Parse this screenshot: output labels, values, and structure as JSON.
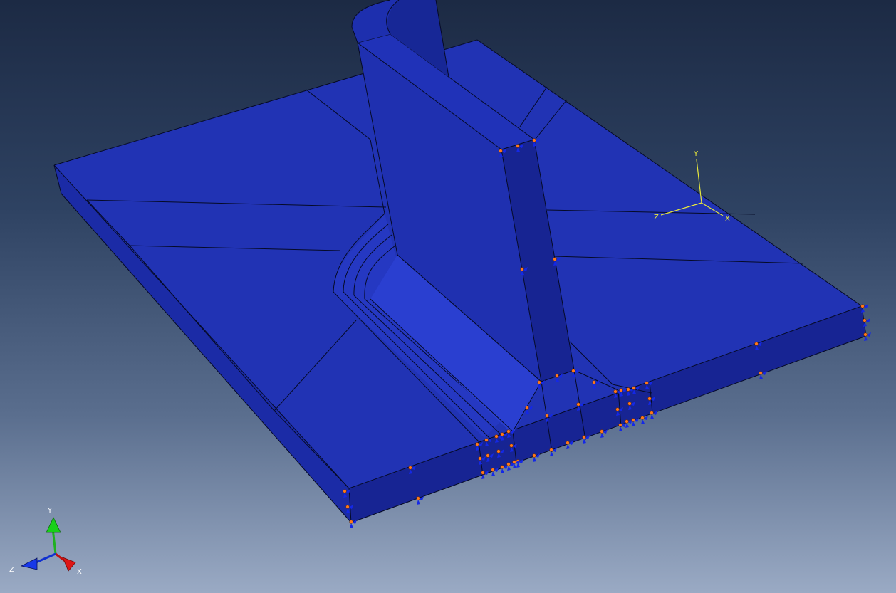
{
  "viewport": {
    "background_top": "#1c2a44",
    "background_bottom": "#9aaac4",
    "part_color": "#1e32b4",
    "edge_color": "#050a26"
  },
  "csys_local": {
    "label_x": "X",
    "label_y": "Y",
    "label_z": "Z",
    "color": "#e8e83c"
  },
  "triad": {
    "label_x": "X",
    "label_y": "Y",
    "label_z": "Z",
    "x_color": "#cc1010",
    "y_color": "#10c010",
    "z_color": "#1030e0"
  },
  "boundary_condition": {
    "icon": "displacement-bc-marker",
    "triangle_color": "#1428e6",
    "dot_color": "#ff7a1a"
  }
}
